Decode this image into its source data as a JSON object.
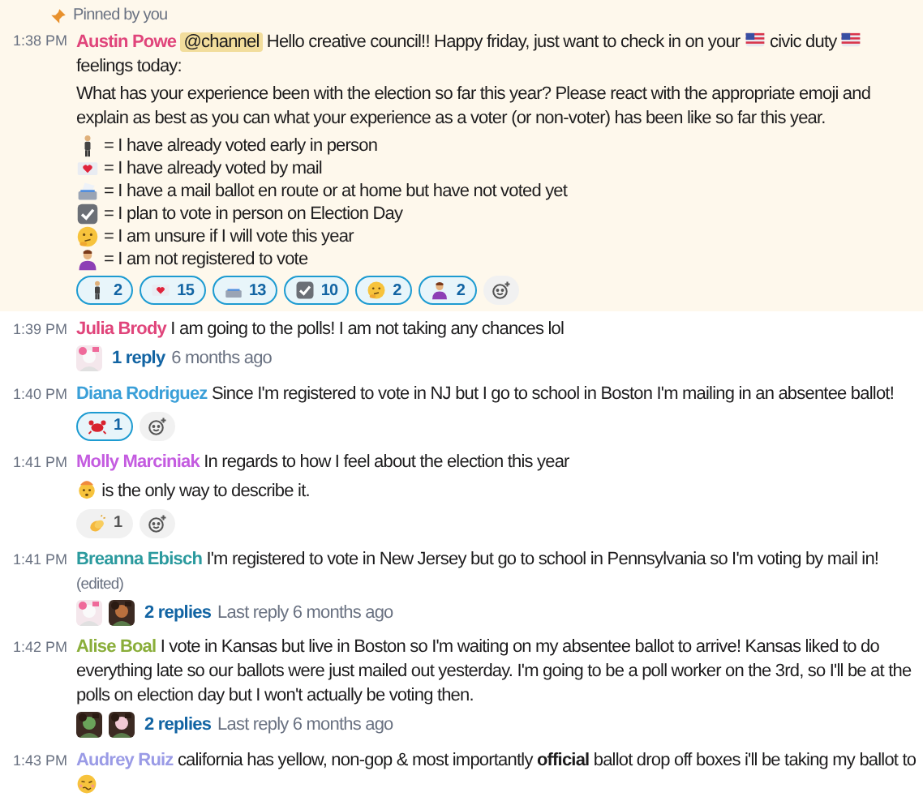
{
  "messages": [
    {
      "time": "1:38 PM",
      "author": "Austin Powe",
      "color": "#e0457b",
      "pin": {
        "label": "Pinned by you"
      },
      "paragraphs": [
        [
          {
            "kind": "mention",
            "text": "@channel"
          },
          {
            "kind": "text",
            "text": "Hello creative council!! Happy friday, just want to check in on your"
          },
          {
            "kind": "flag"
          },
          {
            "kind": "text",
            "text": "civic duty"
          },
          {
            "kind": "flag"
          },
          {
            "kind": "text",
            "text": "feelings today:"
          }
        ],
        [
          {
            "kind": "text",
            "text": "What has your experience been with the election so far this year? Please react with the appropriate emoji and explain as best as you can what your experience as a voter (or non-voter) has been like so far this year."
          }
        ]
      ],
      "legend": [
        {
          "kind": "voter",
          "text": "= I have already voted early in person"
        },
        {
          "kind": "heartmail",
          "text": "= I have already voted by mail"
        },
        {
          "kind": "ballot",
          "text": "= I have a mail ballot en route or at home but have not voted yet"
        },
        {
          "kind": "check",
          "text": "= I plan to vote in person on Election Day"
        },
        {
          "kind": "thinking",
          "text": "= I am unsure if I will vote this year"
        },
        {
          "kind": "person",
          "text": "= I am not registered to vote"
        }
      ],
      "reactions": [
        {
          "kind": "voter",
          "count": "2",
          "selected": true
        },
        {
          "kind": "heartmail",
          "count": "15",
          "selected": true
        },
        {
          "kind": "ballot",
          "count": "13",
          "selected": true
        },
        {
          "kind": "check",
          "count": "10",
          "selected": true
        },
        {
          "kind": "thinking",
          "count": "2",
          "selected": true
        },
        {
          "kind": "person",
          "count": "2",
          "selected": true
        }
      ]
    },
    {
      "time": "1:39 PM",
      "author": "Julia Brody",
      "color": "#e0457b",
      "paragraphs": [
        [
          {
            "kind": "text",
            "text": "I am going to the polls! I am not taking any chances lol"
          }
        ]
      ],
      "thread": {
        "replies": "1 reply",
        "last": "6 months ago"
      }
    },
    {
      "time": "1:40 PM",
      "author": "Diana Rodriguez",
      "color": "#3a9fd8",
      "paragraphs": [
        [
          {
            "kind": "text",
            "text": "Since I'm registered to vote in NJ but I go to school in Boston I'm mailing in an absentee ballot!"
          }
        ]
      ],
      "reactions": [
        {
          "kind": "crab",
          "count": "1",
          "selected": true
        }
      ]
    },
    {
      "time": "1:41 PM",
      "author": "Molly Marciniak",
      "color": "#c45ce0",
      "paragraphs": [
        [
          {
            "kind": "text",
            "text": "In regards to how I feel about the election this year"
          }
        ],
        [
          {
            "kind": "mindblown"
          },
          {
            "kind": "text",
            "text": "is the only way to describe it."
          }
        ]
      ],
      "reactions": [
        {
          "kind": "clap",
          "count": "1",
          "selected": false
        }
      ]
    },
    {
      "time": "1:41 PM",
      "author": "Breanna Ebisch",
      "color": "#2b9a9e",
      "paragraphs": [
        [
          {
            "kind": "text",
            "text": "I'm registered to vote in New Jersey but go to school in Pennsylvania so I'm voting by mail in!"
          },
          {
            "kind": "edited",
            "text": "(edited)"
          }
        ]
      ],
      "thread": {
        "replies": "2 replies",
        "last": "Last reply 6 months ago"
      }
    },
    {
      "time": "1:42 PM",
      "author": "Alise Boal",
      "color": "#8aae3a",
      "paragraphs": [
        [
          {
            "kind": "text",
            "text": "I vote in Kansas but live in Boston so I'm waiting on my absentee ballot to arrive! Kansas liked to do everything late so our ballots were just mailed out yesterday. I'm going to be a poll worker on the 3rd, so I'll be at the polls on election day but I won't actually be voting then."
          }
        ]
      ],
      "thread": {
        "replies": "2 replies",
        "last": "Last reply 6 months ago"
      }
    },
    {
      "time": "1:43 PM",
      "author": "Audrey Ruiz",
      "color": "#9a9be6",
      "paragraphs": [
        [
          {
            "kind": "text",
            "text": "california has yellow, non-gop & most importantly **official** ballot drop off boxes i'll be taking my ballot to"
          },
          {
            "kind": "woozy"
          }
        ]
      ]
    }
  ]
}
